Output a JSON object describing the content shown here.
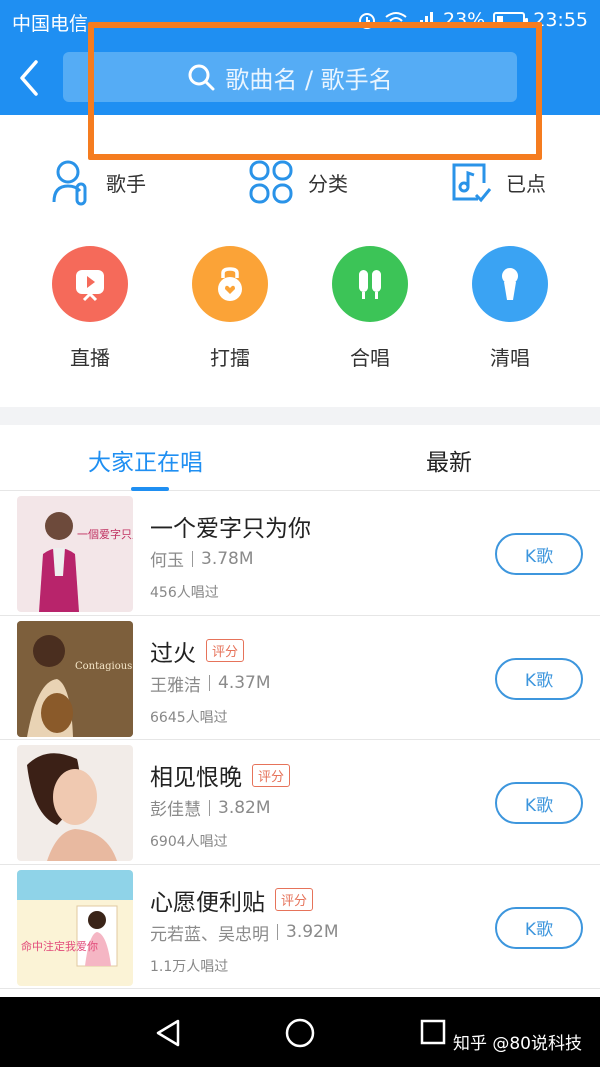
{
  "status_bar": {
    "carrier": "中国电信",
    "battery": "23%",
    "time": "23:55",
    "battery_level": 0.23
  },
  "header": {
    "search_placeholder": "歌曲名 / 歌手名",
    "accent": "#1f8ff2",
    "highlight_color": "#f57c1f"
  },
  "quick_links": [
    {
      "label": "歌手",
      "icon": "singer-icon"
    },
    {
      "label": "分类",
      "icon": "category-icon"
    },
    {
      "label": "已点",
      "icon": "ordered-songs-icon"
    }
  ],
  "features": [
    {
      "label": "直播",
      "icon": "live-play-icon",
      "color": "#f56a5a"
    },
    {
      "label": "打擂",
      "icon": "kettlebell-icon",
      "color": "#fba337"
    },
    {
      "label": "合唱",
      "icon": "duet-mic-icon",
      "color": "#3cc457"
    },
    {
      "label": "清唱",
      "icon": "microphone-icon",
      "color": "#3aa3f3"
    }
  ],
  "tabs": [
    {
      "label": "大家正在唱",
      "active": true
    },
    {
      "label": "最新",
      "active": false
    }
  ],
  "songs": [
    {
      "title": "一个爱字只为你",
      "badge": "",
      "artist": "何玉",
      "size": "3.78M",
      "sung": "456人唱过",
      "button": "K歌",
      "cover_art_text": "一個爱字只爲你"
    },
    {
      "title": "过火",
      "badge": "评分",
      "artist": "王雅洁",
      "size": "4.37M",
      "sung": "6645人唱过",
      "button": "K歌",
      "cover_art_text": "Contagious Love"
    },
    {
      "title": "相见恨晚",
      "badge": "评分",
      "artist": "彭佳慧",
      "size": "3.82M",
      "sung": "6904人唱过",
      "button": "K歌",
      "cover_art_text": ""
    },
    {
      "title": "心愿便利贴",
      "badge": "评分",
      "artist": "元若蓝、吴忠明",
      "size": "3.92M",
      "sung": "1.1万人唱过",
      "button": "K歌",
      "cover_art_text": "命中注定我爱你"
    }
  ],
  "watermark": "知乎 @80说科技"
}
